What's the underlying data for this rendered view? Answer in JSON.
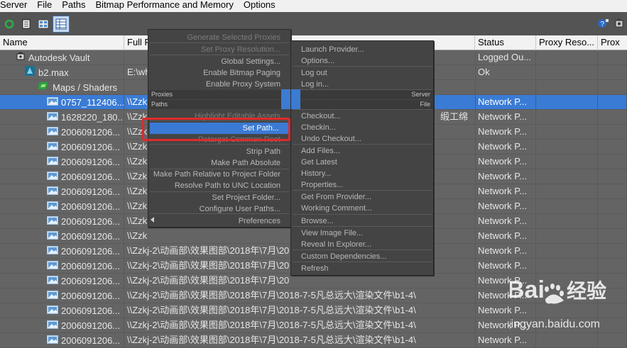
{
  "menubar": [
    "Server",
    "File",
    "Paths",
    "Bitmap Performance and Memory",
    "Options"
  ],
  "toolbar": {
    "icons": [
      "refresh-icon",
      "list-icon",
      "thumbnails-icon",
      "details-icon"
    ],
    "right_icons": [
      "help-icon",
      "vault-icon"
    ]
  },
  "columns": [
    "Name",
    "Full P",
    "Status",
    "Proxy Reso...",
    "Prox"
  ],
  "rows": [
    {
      "name": "Autodesk Vault",
      "path": "",
      "status": "Logged Ou...",
      "indent": 1,
      "icon": "vault"
    },
    {
      "name": "b2.max",
      "path": "E:\\wh",
      "status": "Ok",
      "indent": 2,
      "icon": "max"
    },
    {
      "name": "Maps / Shaders",
      "path": "",
      "status": "",
      "indent": 3,
      "icon": "maps"
    },
    {
      "name": "0757_112406...",
      "path": "\\\\Zzk",
      "status": "Network P...",
      "indent": 4,
      "icon": "image",
      "selected": true
    },
    {
      "name": "1628220_180...",
      "path": "\\\\Zzk",
      "status": "Network P...",
      "indent": 4,
      "icon": "image",
      "extra": "缎工绵"
    },
    {
      "name": "2006091206...",
      "path": "\\\\Zzk",
      "status": "Network P...",
      "indent": 4,
      "icon": "image"
    },
    {
      "name": "2006091206...",
      "path": "\\\\Zzk",
      "status": "Network P...",
      "indent": 4,
      "icon": "image"
    },
    {
      "name": "2006091206...",
      "path": "\\\\Zzk",
      "status": "Network P...",
      "indent": 4,
      "icon": "image"
    },
    {
      "name": "2006091206...",
      "path": "\\\\Zzk",
      "status": "Network P...",
      "indent": 4,
      "icon": "image"
    },
    {
      "name": "2006091206...",
      "path": "\\\\Zzk",
      "status": "Network P...",
      "indent": 4,
      "icon": "image"
    },
    {
      "name": "2006091206...",
      "path": "\\\\Zzk",
      "status": "Network P...",
      "indent": 4,
      "icon": "image"
    },
    {
      "name": "2006091206...",
      "path": "\\\\Zzk",
      "status": "Network P...",
      "indent": 4,
      "icon": "image"
    },
    {
      "name": "2006091206...",
      "path": "\\\\Zzk",
      "status": "Network P...",
      "indent": 4,
      "icon": "image"
    },
    {
      "name": "2006091206...",
      "path": "\\\\Zzkj-2\\动画部\\效果图部\\2018年\\7月\\20",
      "status": "Network P...",
      "indent": 4,
      "icon": "image"
    },
    {
      "name": "2006091206...",
      "path": "\\\\Zzkj-2\\动画部\\效果图部\\2018年\\7月\\20",
      "status": "Network P...",
      "indent": 4,
      "icon": "image"
    },
    {
      "name": "2006091206...",
      "path": "\\\\Zzkj-2\\动画部\\效果图部\\2018年\\7月\\20",
      "status": "Network P...",
      "indent": 4,
      "icon": "image"
    },
    {
      "name": "2006091206...",
      "path": "\\\\Zzkj-2\\动画部\\效果图部\\2018年\\7月\\2018-7-5凡总远大\\渲染文件\\b1-4\\",
      "status": "Network P...",
      "indent": 4,
      "icon": "image"
    },
    {
      "name": "2006091206...",
      "path": "\\\\Zzkj-2\\动画部\\效果图部\\2018年\\7月\\2018-7-5凡总远大\\渲染文件\\b1-4\\",
      "status": "Network P...",
      "indent": 4,
      "icon": "image"
    },
    {
      "name": "2006091206...",
      "path": "\\\\Zzkj-2\\动画部\\效果图部\\2018年\\7月\\2018-7-5凡总远大\\渲染文件\\b1-4\\",
      "status": "Network P...",
      "indent": 4,
      "icon": "image"
    },
    {
      "name": "2006091206...",
      "path": "\\\\Zzkj-2\\动画部\\效果图部\\2018年\\7月\\2018-7-5凡总远大\\渲染文件\\b1-4\\",
      "status": "Network P...",
      "indent": 4,
      "icon": "image"
    }
  ],
  "context_menu_left": [
    {
      "label": "Generate Selected Proxies",
      "disabled": true
    },
    {
      "label": "Set Proxy Resolution...",
      "disabled": true
    },
    {
      "label": "Global Settings..."
    },
    {
      "label": "Enable Bitmap Paging"
    },
    {
      "label": "Enable Proxy System"
    },
    {
      "label": "Highlight Editable Assets",
      "disabled": true
    },
    {
      "label": "Set Path...",
      "highlighted": true
    },
    {
      "label": "Retarget Common Root",
      "disabled": true
    },
    {
      "label": "Strip Path"
    },
    {
      "label": "Make Path Absolute"
    },
    {
      "label": "Make Path Relative to Project Folder"
    },
    {
      "label": "Resolve Path to UNC Location"
    },
    {
      "label": "Set Project Folder..."
    },
    {
      "label": "Configure User Paths..."
    },
    {
      "label": "Preferences"
    }
  ],
  "submenu_headers": {
    "left1": "Proxies",
    "left2": "Paths",
    "right1": "Server",
    "right2": "File"
  },
  "context_menu_right": [
    {
      "label": "Launch Provider..."
    },
    {
      "label": "Options..."
    },
    {
      "label": "Log out"
    },
    {
      "label": "Log in..."
    },
    {
      "label": "Checkout..."
    },
    {
      "label": "Checkin..."
    },
    {
      "label": "Undo Checkout..."
    },
    {
      "label": "Add Files..."
    },
    {
      "label": "Get Latest"
    },
    {
      "label": "History..."
    },
    {
      "label": "Properties..."
    },
    {
      "label": "Get From Provider..."
    },
    {
      "label": "Working Comment..."
    },
    {
      "label": "Browse..."
    },
    {
      "label": "View Image File..."
    },
    {
      "label": "Reveal In Explorer..."
    },
    {
      "label": "Custom Dependencies..."
    },
    {
      "label": "Refresh"
    }
  ],
  "watermark": {
    "text": "Baidu经验",
    "url": "jingyan.baidu.com"
  },
  "colors": {
    "accent": "#3b7ad4",
    "highlight_box": "#e02a2a",
    "background": "#646464"
  }
}
